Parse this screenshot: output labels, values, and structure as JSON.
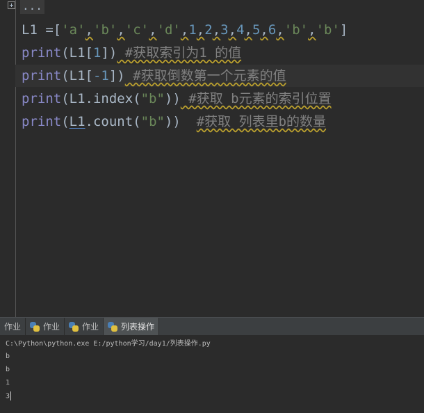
{
  "editor": {
    "folded_text": "...",
    "lines": [
      {
        "var": "L1",
        "assign": " =[",
        "items": [
          {
            "text": "'a'",
            "type": "str"
          },
          {
            "text": "'b'",
            "type": "str"
          },
          {
            "text": "'c'",
            "type": "str"
          },
          {
            "text": "'d'",
            "type": "str"
          },
          {
            "text": "1",
            "type": "num"
          },
          {
            "text": "2",
            "type": "num"
          },
          {
            "text": "3",
            "type": "num"
          },
          {
            "text": "4",
            "type": "num"
          },
          {
            "text": "5",
            "type": "num"
          },
          {
            "text": "6",
            "type": "num"
          },
          {
            "text": "'b'",
            "type": "str"
          },
          {
            "text": "'b'",
            "type": "str"
          }
        ],
        "close": "]"
      },
      {
        "kw": "print",
        "code": "(L1[",
        "num": "1",
        "code_end": "])",
        "comment": " #获取索引为1 的值"
      },
      {
        "kw": "print",
        "code": "(L1[",
        "num": "-1",
        "code_end": "])",
        "comment": " #获取倒数第一个元素的值"
      },
      {
        "kw": "print",
        "code": "(L1.index(",
        "str": "\"b\"",
        "code_end": "))",
        "comment": " #获取 b元素的索引位置"
      },
      {
        "kw": "print",
        "open": "(",
        "ref": "L1",
        "code": ".count(",
        "str": "\"b\"",
        "code_end": "))  ",
        "comment": "#获取 列表里b的数量"
      }
    ]
  },
  "tabs": [
    {
      "label": "作业",
      "icon": "python-icon"
    },
    {
      "label": "作业",
      "icon": "python-icon"
    },
    {
      "label": "作业",
      "icon": "python-icon"
    },
    {
      "label": "列表操作",
      "icon": "python-icon"
    }
  ],
  "console": {
    "command": "C:\\Python\\python.exe E:/python学习/day1/列表操作.py",
    "output": [
      "b",
      "b",
      "1",
      "3"
    ]
  }
}
